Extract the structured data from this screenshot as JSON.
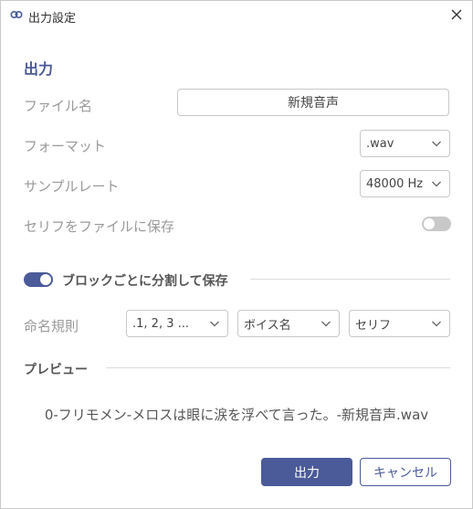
{
  "window": {
    "title": "出力設定",
    "icon": "app-logo-icon"
  },
  "output_section": {
    "heading": "出力"
  },
  "file_name": {
    "label": "ファイル名",
    "value": "新規音声"
  },
  "format": {
    "label": "フォーマット",
    "selected": ".wav"
  },
  "sample_rate": {
    "label": "サンプルレート",
    "selected": "48000 Hz"
  },
  "save_serif": {
    "label": "セリフをファイルに保存",
    "enabled": false
  },
  "split_blocks": {
    "label": "ブロックごとに分割して保存",
    "enabled": true
  },
  "naming": {
    "label": "命名規則",
    "options": [
      ".1, 2, 3 ...",
      "ボイス名",
      "セリフ"
    ]
  },
  "preview": {
    "heading": "プレビュー",
    "text": "0-フリモメン-メロスは眼に涙を浮べて言った。-新規音声.wav"
  },
  "buttons": {
    "primary": "出力",
    "secondary": "キャンセル"
  },
  "colors": {
    "accent": "#4b5a99",
    "muted_label": "#9a9a9a"
  }
}
